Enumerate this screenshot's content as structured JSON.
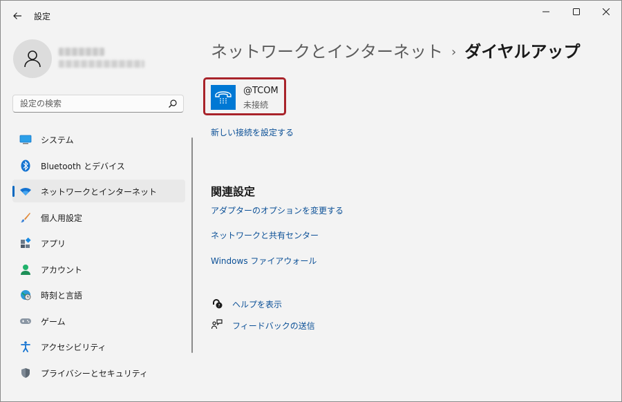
{
  "window": {
    "title": "設定"
  },
  "sidebar": {
    "search_placeholder": "設定の検索",
    "items": [
      {
        "label": "システム",
        "icon": "system-icon"
      },
      {
        "label": "Bluetooth とデバイス",
        "icon": "bluetooth-icon"
      },
      {
        "label": "ネットワークとインターネット",
        "icon": "network-icon",
        "active": true
      },
      {
        "label": "個人用設定",
        "icon": "brush-icon"
      },
      {
        "label": "アプリ",
        "icon": "apps-icon"
      },
      {
        "label": "アカウント",
        "icon": "account-icon"
      },
      {
        "label": "時刻と言語",
        "icon": "time-language-icon"
      },
      {
        "label": "ゲーム",
        "icon": "gamepad-icon"
      },
      {
        "label": "アクセシビリティ",
        "icon": "accessibility-icon"
      },
      {
        "label": "プライバシーとセキュリティ",
        "icon": "shield-icon"
      }
    ]
  },
  "main": {
    "breadcrumb_parent": "ネットワークとインターネット",
    "breadcrumb_separator": "›",
    "breadcrumb_current": "ダイヤルアップ",
    "connection": {
      "name": "@TCOM",
      "status": "未接続"
    },
    "new_connection_link": "新しい接続を設定する",
    "related_title": "関連設定",
    "related_links": [
      "アダプターのオプションを変更する",
      "ネットワークと共有センター",
      "Windows ファイアウォール"
    ],
    "help_link": "ヘルプを表示",
    "feedback_link": "フィードバックの送信"
  },
  "colors": {
    "accent": "#0067c0",
    "link": "#0a4f96",
    "highlight_border": "#a8232a",
    "tile": "#0078d4"
  }
}
